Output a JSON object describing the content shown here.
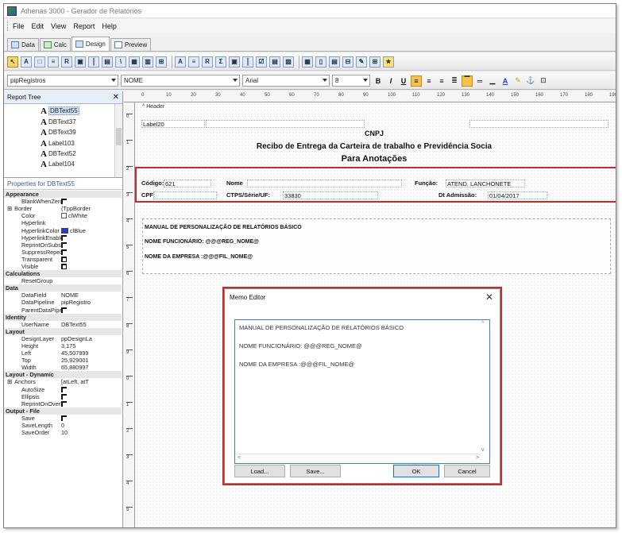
{
  "window": {
    "title": "Athenas 3000 - Gerador de Relatórios"
  },
  "menu": [
    "File",
    "Edit",
    "View",
    "Report",
    "Help"
  ],
  "tabs": [
    "Data",
    "Calc",
    "Design",
    "Preview"
  ],
  "format_bar": {
    "pipeline": "pipRegistros",
    "field": "NOME",
    "font": "Arial",
    "size": "8",
    "bold": "B",
    "italic": "I",
    "underline": "U"
  },
  "report_tree": {
    "title": "Report Tree",
    "items": [
      "DBText55",
      "DBText37",
      "DBText39",
      "Label103",
      "DBText52",
      "Label104"
    ]
  },
  "properties": {
    "title": "Properties for DBText55",
    "rows": [
      {
        "cat": "Appearance"
      },
      {
        "name": "BlankWhenZero",
        "value": "",
        "kind": "box"
      },
      {
        "name": "Border",
        "value": "(TppBorder",
        "kind": "text",
        "plus": "⊞"
      },
      {
        "name": "Color",
        "value": "clWhite",
        "kind": "chk"
      },
      {
        "name": "Hyperlink",
        "value": "",
        "kind": "text"
      },
      {
        "name": "HyperlinkColor",
        "value": "clBlue",
        "kind": "swatch",
        "color": "#1a3fd8"
      },
      {
        "name": "HyperlinkEnabled",
        "value": "",
        "kind": "box"
      },
      {
        "name": "ReprintOnSubseq",
        "value": "",
        "kind": "box"
      },
      {
        "name": "SuppressRepeate",
        "value": "",
        "kind": "box"
      },
      {
        "name": "Transparent",
        "value": "",
        "kind": "checked"
      },
      {
        "name": "Visible",
        "value": "",
        "kind": "checked"
      },
      {
        "cat": "Calculations"
      },
      {
        "name": "ResetGroup",
        "value": "",
        "kind": "text"
      },
      {
        "cat": "Data"
      },
      {
        "name": "DataField",
        "value": "NOME",
        "kind": "text"
      },
      {
        "name": "DataPipeline",
        "value": "pipRegistro",
        "kind": "text"
      },
      {
        "name": "ParentDataPipelin",
        "value": "",
        "kind": "box"
      },
      {
        "cat": "Identity"
      },
      {
        "name": "UserName",
        "value": "DBText55",
        "kind": "text"
      },
      {
        "cat": "Layout"
      },
      {
        "name": "DesignLayer",
        "value": "ppDesignLa",
        "kind": "text"
      },
      {
        "name": "Height",
        "value": "3,175",
        "kind": "text"
      },
      {
        "name": "Left",
        "value": "45,507999",
        "kind": "text"
      },
      {
        "name": "Top",
        "value": "25,929001",
        "kind": "text"
      },
      {
        "name": "Width",
        "value": "65,880997",
        "kind": "text"
      },
      {
        "cat": "Layout - Dynamic"
      },
      {
        "name": "Anchors",
        "value": "[atLeft, atT",
        "kind": "text",
        "plus": "⊞"
      },
      {
        "name": "AutoSize",
        "value": "",
        "kind": "box"
      },
      {
        "name": "Ellipsis",
        "value": "",
        "kind": "box"
      },
      {
        "name": "ReprintOnOverFlo",
        "value": "",
        "kind": "box"
      },
      {
        "cat": "Output - File"
      },
      {
        "name": "Save",
        "value": "",
        "kind": "box"
      },
      {
        "name": "SaveLength",
        "value": "0",
        "kind": "text"
      },
      {
        "name": "SaveOrder",
        "value": "10",
        "kind": "text"
      }
    ]
  },
  "ruler": {
    "ticks": [
      "0",
      "10",
      "20",
      "30",
      "40",
      "50",
      "60",
      "70",
      "80",
      "90",
      "100",
      "110",
      "120",
      "130",
      "140",
      "150",
      "160",
      "170",
      "180",
      "190"
    ],
    "v_ticks": [
      "0",
      "1",
      "2",
      "3",
      "4",
      "5",
      "6",
      "7",
      "8",
      "9",
      "0",
      "1",
      "2",
      "3",
      "4",
      "5"
    ]
  },
  "design": {
    "band": "^ Header",
    "label20": "Label20",
    "cnpj": "CNPJ",
    "title1": "Recibo de Entrega da Carteira de trabalho e Previdência Socia",
    "title2": "Para Anotações",
    "codigo_label": "Código:",
    "codigo_value": "621",
    "nome_label": "Nome",
    "funcao_label": "Função:",
    "funcao_value": "ATEND. LANCHONETE",
    "cpf_label": "CPF:",
    "ctps_label": "CTPS/Série/UF:",
    "ctps_value": "33830",
    "admissao_label": "Dt Admissão:",
    "admissao_value": "01/04/2017",
    "memo_line1": "MANUAL DE PERSONALIZAÇÃO DE RELATÓRIOS BÁSICO",
    "memo_line2": "NOME FUNCIONÁRIO: @@@REG_NOME@",
    "memo_line3": "NOME DA EMPRESA :@@@FIL_NOME@"
  },
  "memo_editor": {
    "title": "Memo Editor",
    "lines": [
      "MANUAL DE PERSONALIZAÇÃO DE RELATÓRIOS BÁSICO",
      "NOME FUNCIONÁRIO: @@@REG_NOME@",
      "NOME DA EMPRESA :@@@FIL_NOME@"
    ],
    "load": "Load...",
    "save": "Save...",
    "ok": "OK",
    "cancel": "Cancel"
  },
  "colors": {
    "highlight_red": "#d0272e",
    "accent_blue": "#3c7fcf"
  }
}
